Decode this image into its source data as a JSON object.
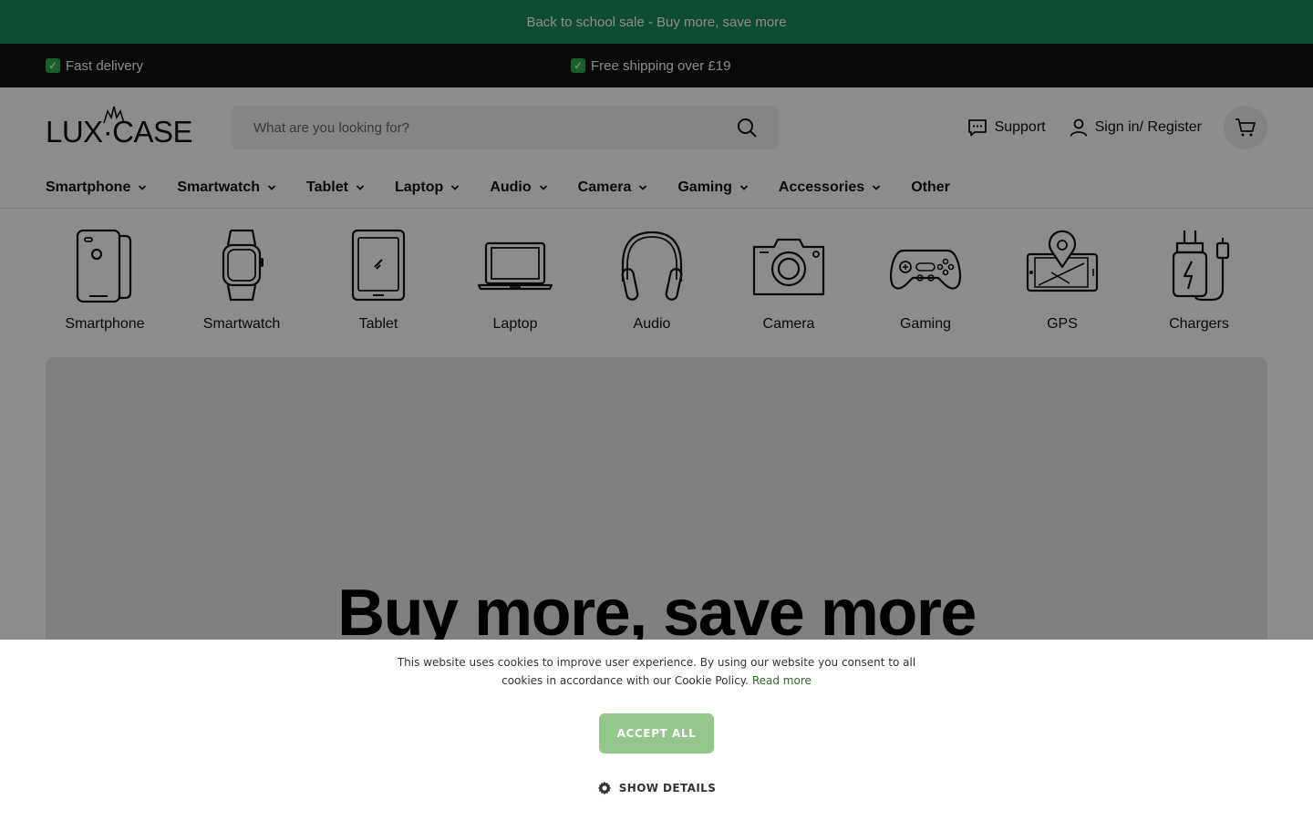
{
  "announcement": "Back to school sale - Buy more, save more",
  "usp": [
    {
      "icon": "check-emoji",
      "text": "Fast delivery"
    },
    {
      "icon": "check-emoji",
      "text": "Free shipping over £19"
    }
  ],
  "header": {
    "logo": "LUX·CASE",
    "search_placeholder": "What are you looking for?",
    "support_label": "Support",
    "signin_label": "Sign in/ Register"
  },
  "nav": [
    "Smartphone",
    "Smartwatch",
    "Tablet",
    "Laptop",
    "Audio",
    "Camera",
    "Gaming",
    "Accessories",
    "Other"
  ],
  "categories": [
    "Smartphone",
    "Smartwatch",
    "Tablet",
    "Laptop",
    "Audio",
    "Camera",
    "Gaming",
    "GPS",
    "Chargers"
  ],
  "hero": {
    "title": "Buy more, save more"
  },
  "cookie": {
    "message": "This website uses cookies to improve user experience. By using our website you consent to all cookies in accordance with our Cookie Policy.",
    "read_more": "Read more",
    "accept_label": "ACCEPT ALL",
    "details_label": "SHOW DETAILS"
  },
  "colors": {
    "announcement_bg": "#1b8a5a",
    "usp_bg": "#111111",
    "accept_bg": "#93c88a",
    "link": "#2b6d23"
  }
}
